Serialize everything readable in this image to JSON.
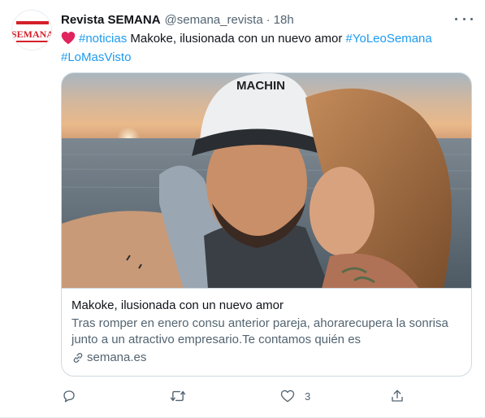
{
  "tweet": {
    "author_name": "Revista SEMANA",
    "handle": "@semana_revista",
    "separator": "·",
    "time": "18h",
    "avatar_text": "SEMANA",
    "text": {
      "hashtag_1": "#noticias",
      "body": " Makoke, ilusionada con un nuevo amor ",
      "hashtag_2": "#YoLeoSemana",
      "hashtag_3": "#LoMasVisto"
    }
  },
  "card": {
    "cap_text": "MACHIN",
    "title": "Makoke, ilusionada con un nuevo amor",
    "description": "Tras romper en enero consu anterior pareja, ahorarecupera la sonrisa junto a un atractivo empresario.Te contamos quién es",
    "domain": "semana.es"
  },
  "actions": {
    "reply_count": "",
    "retweet_count": "",
    "like_count": "3",
    "icons": [
      "reply-icon",
      "retweet-icon",
      "like-icon",
      "share-icon"
    ]
  },
  "colors": {
    "accent": "#1d9bf0",
    "secondary_text": "#536471",
    "heart": "#e0245e",
    "brand_red": "#d4202a"
  }
}
